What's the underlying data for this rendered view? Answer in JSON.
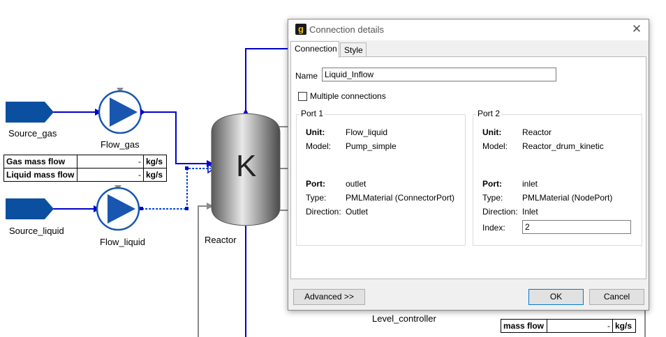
{
  "flowsheet": {
    "source_gas": "Source_gas",
    "source_liquid": "Source_liquid",
    "flow_gas": "Flow_gas",
    "flow_liquid": "Flow_liquid",
    "reactor": "Reactor",
    "reactor_symbol": "K",
    "level_controller": "Level_controller",
    "table1": {
      "rows": [
        {
          "label": "Gas mass flow",
          "value": "-",
          "unit": "kg/s"
        },
        {
          "label": "Liquid mass flow",
          "value": "-",
          "unit": "kg/s"
        }
      ]
    },
    "table2": {
      "rows": [
        {
          "label": "mass flow",
          "value": "-",
          "unit": "kg/s"
        }
      ]
    }
  },
  "dialog": {
    "title": "Connection details",
    "close_glyph": "✕",
    "app_icon": "g",
    "tabs": [
      "Connection",
      "Style"
    ],
    "name_label": "Name",
    "name_value": "Liquid_Inflow",
    "multiple_label": "Multiple connections",
    "multiple_checked": false,
    "port1": {
      "title": "Port 1",
      "unit_label": "Unit:",
      "unit": "Flow_liquid",
      "model_label": "Model:",
      "model": "Pump_simple",
      "port_label": "Port:",
      "port": "outlet",
      "type_label": "Type:",
      "type": "PMLMaterial (ConnectorPort)",
      "direction_label": "Direction:",
      "direction": "Outlet"
    },
    "port2": {
      "title": "Port 2",
      "unit_label": "Unit:",
      "unit": "Reactor",
      "model_label": "Model:",
      "model": "Reactor_drum_kinetic",
      "port_label": "Port:",
      "port": "inlet",
      "type_label": "Type:",
      "type": "PMLMaterial (NodePort)",
      "direction_label": "Direction:",
      "direction": "Inlet",
      "index_label": "Index:",
      "index": "2"
    },
    "advanced_button": "Advanced >>",
    "ok_button": "OK",
    "cancel_button": "Cancel"
  },
  "colors": {
    "stream": "#0000cc",
    "source": "#0b4fa0",
    "pump": "#1856b0"
  }
}
